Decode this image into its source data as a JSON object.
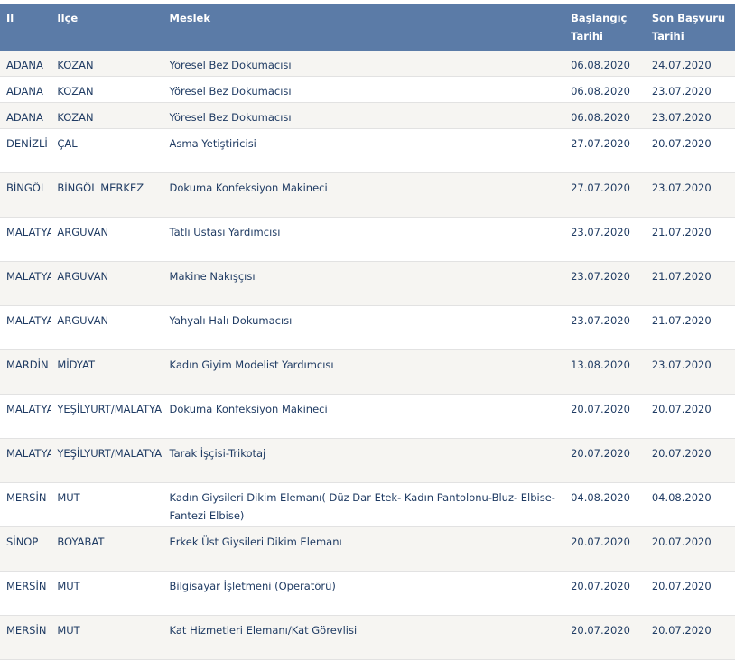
{
  "table": {
    "headers": {
      "il": "Il",
      "ilce": "Ilçe",
      "meslek": "Meslek",
      "baslangic_1": "Başlangıç",
      "baslangic_2": "Tarihi",
      "son_1": "Son Başvuru",
      "son_2": "Tarihi"
    },
    "rows": [
      {
        "il": "ADANA",
        "ilce": "KOZAN",
        "meslek": "Yöresel Bez Dokumacısı",
        "baslangic": "06.08.2020",
        "son": "24.07.2020"
      },
      {
        "il": "ADANA",
        "ilce": "KOZAN",
        "meslek": "Yöresel Bez Dokumacısı",
        "baslangic": "06.08.2020",
        "son": "23.07.2020"
      },
      {
        "il": "ADANA",
        "ilce": "KOZAN",
        "meslek": "Yöresel Bez Dokumacısı",
        "baslangic": "06.08.2020",
        "son": "23.07.2020"
      },
      {
        "il": "DENİZLİ",
        "ilce": "ÇAL",
        "meslek": "Asma Yetiştiricisi",
        "baslangic": "27.07.2020",
        "son": "20.07.2020"
      },
      {
        "il": "BİNGÖL",
        "ilce": "BİNGÖL MERKEZ",
        "meslek": "Dokuma Konfeksiyon Makineci",
        "baslangic": "27.07.2020",
        "son": "23.07.2020"
      },
      {
        "il": "MALATYA",
        "ilce": "ARGUVAN",
        "meslek": "Tatlı Ustası Yardımcısı",
        "baslangic": "23.07.2020",
        "son": "21.07.2020"
      },
      {
        "il": "MALATYA",
        "ilce": "ARGUVAN",
        "meslek": "Makine Nakışçısı",
        "baslangic": "23.07.2020",
        "son": "21.07.2020"
      },
      {
        "il": "MALATYA",
        "ilce": "ARGUVAN",
        "meslek": "Yahyalı Halı Dokumacısı",
        "baslangic": "23.07.2020",
        "son": "21.07.2020"
      },
      {
        "il": "MARDİN",
        "ilce": "MİDYAT",
        "meslek": "Kadın Giyim Modelist Yardımcısı",
        "baslangic": "13.08.2020",
        "son": "23.07.2020"
      },
      {
        "il": "MALATYA",
        "ilce": "YEŞİLYURT/MALATYA",
        "meslek": "Dokuma Konfeksiyon Makineci",
        "baslangic": "20.07.2020",
        "son": "20.07.2020"
      },
      {
        "il": "MALATYA",
        "ilce": "YEŞİLYURT/MALATYA",
        "meslek": "Tarak İşçisi-Trikotaj",
        "baslangic": "20.07.2020",
        "son": "20.07.2020"
      },
      {
        "il": "MERSİN",
        "ilce": "MUT",
        "meslek": "Kadın Giysileri Dikim Elemanı( Düz Dar Etek- Kadın Pantolonu-Bluz- Elbise-Fantezi Elbise)",
        "baslangic": "04.08.2020",
        "son": "04.08.2020"
      },
      {
        "il": "SİNOP",
        "ilce": "BOYABAT",
        "meslek": "Erkek Üst Giysileri Dikim Elemanı",
        "baslangic": "20.07.2020",
        "son": "20.07.2020"
      },
      {
        "il": "MERSİN",
        "ilce": "MUT",
        "meslek": "Bilgisayar İşletmeni (Operatörü)",
        "baslangic": "20.07.2020",
        "son": "20.07.2020"
      },
      {
        "il": "MERSİN",
        "ilce": "MUT",
        "meslek": "Kat Hizmetleri Elemanı/Kat Görevlisi",
        "baslangic": "20.07.2020",
        "son": "20.07.2020"
      }
    ]
  },
  "colors": {
    "header_bg": "#5b7ba7",
    "row_alt_bg": "#f6f5f2",
    "text": "#1f3b63"
  }
}
